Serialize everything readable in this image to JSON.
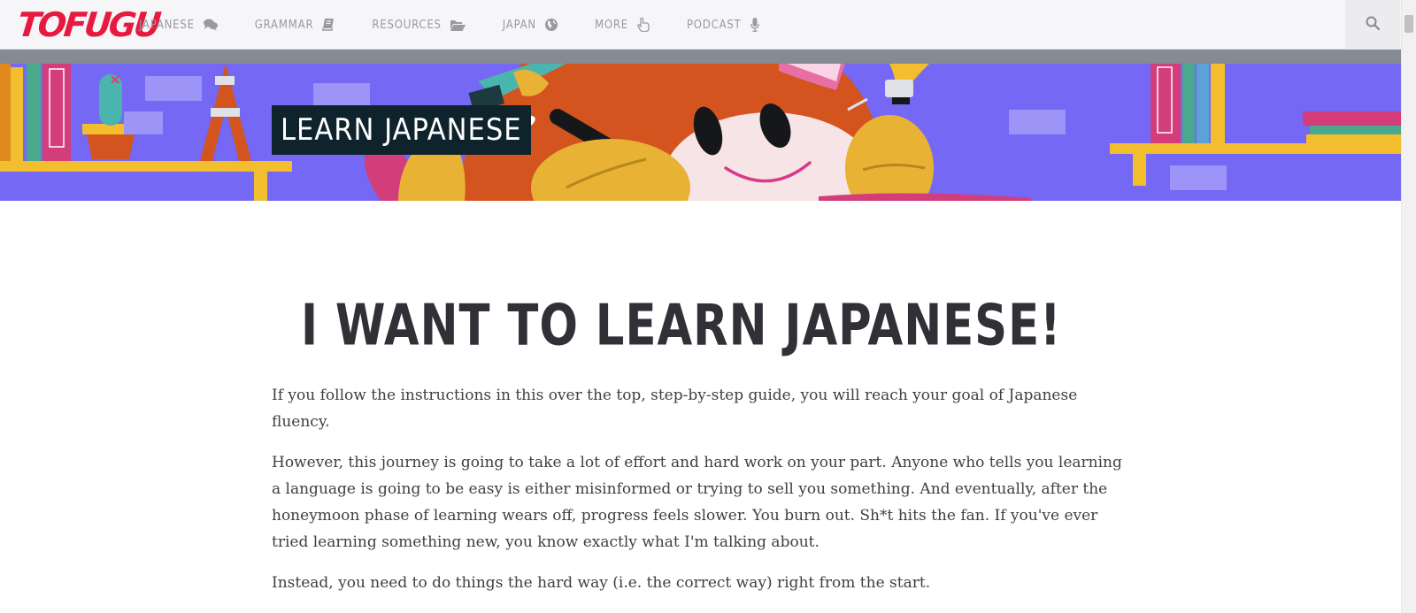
{
  "header": {
    "logo": "TOFUGU",
    "nav": [
      {
        "label": "JAPANESE",
        "icon": "chat-bubbles-icon"
      },
      {
        "label": "GRAMMAR",
        "icon": "book-icon"
      },
      {
        "label": "RESOURCES",
        "icon": "folder-open-icon"
      },
      {
        "label": "JAPAN",
        "icon": "globe-icon"
      },
      {
        "label": "MORE",
        "icon": "pointing-hand-icon"
      },
      {
        "label": "PODCAST",
        "icon": "microphone-icon"
      }
    ],
    "search_icon": "search-icon"
  },
  "banner": {
    "title": "LEARN JAPANESE"
  },
  "article": {
    "title": "I WANT TO LEARN JAPANESE!",
    "paragraphs": [
      "If you follow the instructions in this over the top, step-by-step guide, you will reach your goal of Japanese fluency.",
      "However, this journey is going to take a lot of effort and hard work on your part. Anyone who tells you learning a language is going to be easy is either misinformed or trying to sell you something. And eventually, after the honeymoon phase of learning wears off, progress feels slower. You burn out. Sh*t hits the fan. If you've ever tried learning something new, you know exactly what I'm talking about.",
      "Instead, you need to do things the hard way (i.e. the correct way) right from the start."
    ]
  },
  "colors": {
    "brand_red": "#e8193e",
    "banner_purple": "#7468f4",
    "title_box": "#0f232d"
  }
}
